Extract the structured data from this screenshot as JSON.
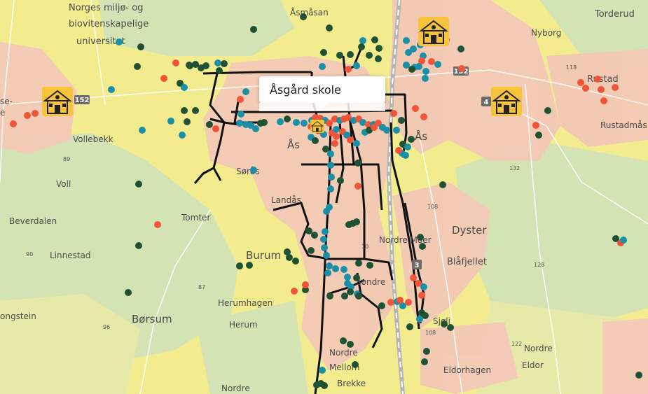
{
  "map": {
    "places": [
      {
        "name": "Norges miljø- og",
        "size": "md"
      },
      {
        "name": "biovitenskapelige",
        "size": "md"
      },
      {
        "name": "universitet",
        "size": "md"
      },
      {
        "name": "Åsmåsan",
        "size": "sm"
      },
      {
        "name": "Torderud",
        "size": "md"
      },
      {
        "name": "Nyborg",
        "size": "sm"
      },
      {
        "name": "Rustad",
        "size": "md"
      },
      {
        "name": "Rustadmås",
        "size": "sm"
      },
      {
        "name": "se-",
        "size": "sm"
      },
      {
        "name": "e",
        "size": "sm"
      },
      {
        "name": "Vollebekk",
        "size": "sm"
      },
      {
        "name": "Voll",
        "size": "sm"
      },
      {
        "name": "Ås",
        "size": "lg"
      },
      {
        "name": "Ås",
        "size": "lg"
      },
      {
        "name": "Sørås",
        "size": "sm"
      },
      {
        "name": "Landås",
        "size": "sm"
      },
      {
        "name": "Beverdalen",
        "size": "sm"
      },
      {
        "name": "Tomter",
        "size": "sm"
      },
      {
        "name": "Linnestad",
        "size": "sm"
      },
      {
        "name": "Burum",
        "size": "lg"
      },
      {
        "name": "Dyster",
        "size": "lg"
      },
      {
        "name": "Nordre Moer",
        "size": "sm"
      },
      {
        "name": "Blåfjellet",
        "size": "md"
      },
      {
        "name": "Søndre",
        "size": "sm"
      },
      {
        "name": "Herumhagen",
        "size": "sm"
      },
      {
        "name": "Herum",
        "size": "sm"
      },
      {
        "name": "ongstein",
        "size": "sm"
      },
      {
        "name": "Børsum",
        "size": "lg"
      },
      {
        "name": "Sjøli",
        "size": "sm"
      },
      {
        "name": "Nordre",
        "size": "sm"
      },
      {
        "name": "Nordre",
        "size": "sm"
      },
      {
        "name": "Mellom",
        "size": "sm"
      },
      {
        "name": "Brekke",
        "size": "sm"
      },
      {
        "name": "Eldorhagen",
        "size": "sm"
      },
      {
        "name": "Eldor",
        "size": "sm"
      },
      {
        "name": "Nordre",
        "size": "sm"
      }
    ],
    "road_shields": [
      "152",
      "152",
      "4",
      "3"
    ],
    "elevations": [
      "118",
      "89",
      "90",
      "87",
      "96",
      "108",
      "132",
      "128",
      "122",
      "108",
      "10"
    ],
    "school_icon": "school-icon",
    "colors": {
      "marker_teal": "#1a8fa8",
      "marker_dark_green": "#1f5234",
      "marker_red": "#f0553a",
      "route": "#111111",
      "urban": "#f3c9b6",
      "yellow_land": "#f2ec8f",
      "green_land": "#cfe0b3"
    }
  },
  "popup": {
    "title": "Åsgård skole"
  }
}
